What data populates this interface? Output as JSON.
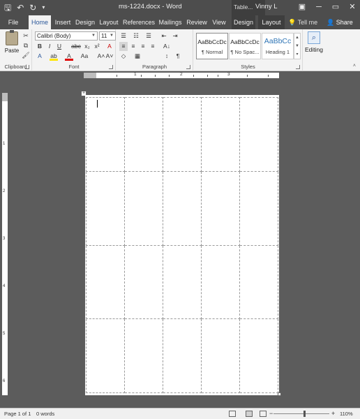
{
  "title_bar": {
    "qat": {
      "save": "🖫",
      "undo": "↶",
      "redo": "↻",
      "customize": "▾"
    },
    "document_title": "ms-1224.docx - Word",
    "context_label": "Table...",
    "user": "Vinny L",
    "window_buttons": {
      "minimize": "─",
      "restore": "▭",
      "close": "✕"
    }
  },
  "tabs": [
    "File",
    "Home",
    "Insert",
    "Design",
    "Layout",
    "References",
    "Mailings",
    "Review",
    "View",
    "Design",
    "Layout"
  ],
  "active_tab": "Home",
  "tell_me": "Tell me",
  "share": "Share",
  "clipboard": {
    "paste_label": "Paste",
    "group_label": "Clipboard"
  },
  "font": {
    "font_name": "Calibri (Body)",
    "font_size": "11",
    "group_label": "Font",
    "buttons": {
      "bold": "B",
      "italic": "I",
      "underline": "U",
      "strikethrough": "abc",
      "subscript": "x₂",
      "superscript": "x²",
      "text_effects": "A",
      "highlight": "ab",
      "font_color": "A",
      "change_case": "Aa",
      "grow": "A˄",
      "shrink": "A˅",
      "clear": "A"
    }
  },
  "paragraph": {
    "group_label": "Paragraph",
    "buttons": {
      "bullets": "☰",
      "numbering": "☷",
      "multilevel": "☰",
      "decrease_indent": "⇤",
      "increase_indent": "⇥",
      "sort": "A↓",
      "show_marks": "¶",
      "align_left": "≡",
      "center": "≡",
      "align_right": "≡",
      "justify": "≡",
      "line_spacing": "↕",
      "shading": "◇",
      "borders": "▦"
    }
  },
  "styles": {
    "group_label": "Styles",
    "items": [
      {
        "sample": "AaBbCcDc",
        "name": "¶ Normal"
      },
      {
        "sample": "AaBbCcDc",
        "name": "¶ No Spac..."
      },
      {
        "sample": "AaBbCc",
        "name": "Heading 1"
      }
    ]
  },
  "editing": {
    "label": "Editing",
    "icon": "⌕"
  },
  "ruler": {
    "top_numbers": [
      "1",
      "2",
      "3"
    ],
    "left_numbers": [
      "1",
      "2",
      "3",
      "4",
      "5",
      "6"
    ]
  },
  "table": {
    "rows": 4,
    "cols": 5
  },
  "status_bar": {
    "page": "Page 1 of 1",
    "words": "0 words",
    "zoom_minus": "−",
    "zoom_plus": "+",
    "zoom_level": "110%"
  }
}
